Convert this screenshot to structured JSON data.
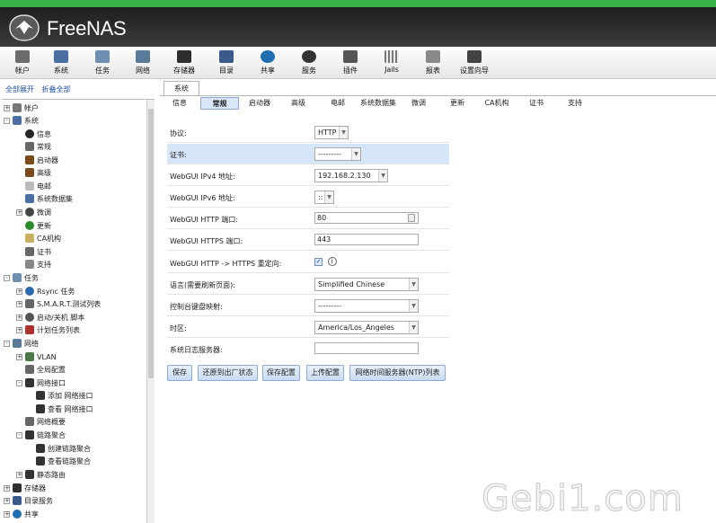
{
  "app": {
    "title": "FreeNAS"
  },
  "toolbar": [
    {
      "label": "帐户",
      "icon": "users-icon",
      "color": "#6b6b6b"
    },
    {
      "label": "系统",
      "icon": "system-icon",
      "color": "#4a6fa0"
    },
    {
      "label": "任务",
      "icon": "tasks-icon",
      "color": "#6f8fb0"
    },
    {
      "label": "网络",
      "icon": "network-icon",
      "color": "#5a7a9a"
    },
    {
      "label": "存储器",
      "icon": "storage-icon",
      "color": "#2e2e2e"
    },
    {
      "label": "目录",
      "icon": "directory-icon",
      "color": "#3a5a8a"
    },
    {
      "label": "共享",
      "icon": "sharing-icon",
      "color": "#1f6fb0"
    },
    {
      "label": "服务",
      "icon": "services-icon",
      "color": "#333333"
    },
    {
      "label": "插件",
      "icon": "plugins-icon",
      "color": "#555555"
    },
    {
      "label": "Jails",
      "icon": "jails-icon",
      "color": "#777777"
    },
    {
      "label": "报表",
      "icon": "reports-icon",
      "color": "#8a8a8a"
    },
    {
      "label": "设置向导",
      "icon": "wizard-icon",
      "color": "#444444"
    }
  ],
  "left": {
    "expand_all": "全部展开",
    "collapse_all": "折叠全部"
  },
  "tree": [
    {
      "label": "帐户",
      "toggle": "+",
      "icon": "users-icon",
      "color": "#777"
    },
    {
      "label": "系统",
      "toggle": "-",
      "icon": "system-icon",
      "color": "#4a6fa0"
    },
    {
      "label": "信息",
      "icon": "info-icon",
      "color": "#222"
    },
    {
      "label": "常规",
      "icon": "wrench-icon",
      "color": "#666"
    },
    {
      "label": "启动器",
      "icon": "boot-icon",
      "color": "#7a4a1a"
    },
    {
      "label": "高级",
      "icon": "advanced-icon",
      "color": "#7a4a1a"
    },
    {
      "label": "电邮",
      "icon": "email-icon",
      "color": "#bbb"
    },
    {
      "label": "系统数据集",
      "icon": "dataset-icon",
      "color": "#4a6fa0"
    },
    {
      "label": "微调",
      "toggle": "+",
      "icon": "tunables-icon",
      "color": "#444"
    },
    {
      "label": "更新",
      "icon": "update-icon",
      "color": "#2a8a2a"
    },
    {
      "label": "CA机构",
      "icon": "ca-icon",
      "color": "#c8b060"
    },
    {
      "label": "证书",
      "icon": "certificate-icon",
      "color": "#666"
    },
    {
      "label": "支持",
      "icon": "support-icon",
      "color": "#888"
    },
    {
      "label": "任务",
      "toggle": "-",
      "icon": "tasks-icon",
      "color": "#6f8fb0"
    },
    {
      "label": "Rsync 任务",
      "toggle": "+",
      "icon": "rsync-icon",
      "color": "#2a6ab0"
    },
    {
      "label": "S.M.A.R.T.测试列表",
      "toggle": "+",
      "icon": "smart-icon",
      "color": "#666"
    },
    {
      "label": "启动/关机 脚本",
      "toggle": "+",
      "icon": "script-icon",
      "color": "#555"
    },
    {
      "label": "计划任务列表",
      "toggle": "+",
      "icon": "cron-icon",
      "color": "#b03030"
    },
    {
      "label": "网络",
      "toggle": "-",
      "icon": "network-icon",
      "color": "#5a7a9a"
    },
    {
      "label": "VLAN",
      "toggle": "+",
      "icon": "vlan-icon",
      "color": "#4a7a4a"
    },
    {
      "label": "全局配置",
      "icon": "wrench-icon",
      "color": "#666"
    },
    {
      "label": "网络接口",
      "toggle": "-",
      "icon": "interface-icon",
      "color": "#333"
    },
    {
      "label": "添加 网络接口",
      "icon": "add-interface-icon",
      "color": "#333"
    },
    {
      "label": "查看 网络接口",
      "icon": "view-interface-icon",
      "color": "#333"
    },
    {
      "label": "网络概要",
      "icon": "wrench-icon",
      "color": "#666"
    },
    {
      "label": "链路聚合",
      "toggle": "-",
      "icon": "lagg-icon",
      "color": "#333"
    },
    {
      "label": "创建链路聚合",
      "icon": "lagg-add-icon",
      "color": "#333"
    },
    {
      "label": "查看链路聚合",
      "icon": "lagg-view-icon",
      "color": "#333"
    },
    {
      "label": "静态路由",
      "toggle": "+",
      "icon": "route-icon",
      "color": "#333"
    },
    {
      "label": "存储器",
      "toggle": "+",
      "icon": "storage-icon",
      "color": "#2e2e2e"
    },
    {
      "label": "目录服务",
      "toggle": "+",
      "icon": "directory-icon",
      "color": "#3a5a8a"
    },
    {
      "label": "共享",
      "toggle": "+",
      "icon": "sharing-icon",
      "color": "#1f6fb0"
    }
  ],
  "main": {
    "tab": "系统",
    "subtabs": [
      "信息",
      "常规",
      "启动器",
      "高级",
      "电邮",
      "系统数据集",
      "微调",
      "更新",
      "CA机构",
      "证书",
      "支持"
    ],
    "form": {
      "protocol_label": "协议:",
      "protocol_value": "HTTP",
      "cert_label": "证书:",
      "cert_value": "---------",
      "ipv4_label": "WebGUI IPv4 地址:",
      "ipv4_value": "192.168.2.130",
      "ipv6_label": "WebGUI IPv6 地址:",
      "ipv6_value": "::",
      "http_port_label": "WebGUI HTTP 端口:",
      "http_port_value": "80",
      "https_port_label": "WebGUI HTTPS 端口:",
      "https_port_value": "443",
      "redirect_label": "WebGUI HTTP -> HTTPS 重定向:",
      "lang_label": "语言(需要刷新页面):",
      "lang_value": "Simplified Chinese",
      "keymap_label": "控制台键盘映射:",
      "keymap_value": "---------",
      "tz_label": "时区:",
      "tz_value": "America/Los_Angeles",
      "syslog_label": "系统日志服务器:",
      "syslog_value": ""
    },
    "buttons": [
      "保存",
      "还原到出厂状态",
      "保存配置",
      "上传配置",
      "网络时间服务器(NTP)列表"
    ]
  },
  "watermark": "Gebi1.com"
}
